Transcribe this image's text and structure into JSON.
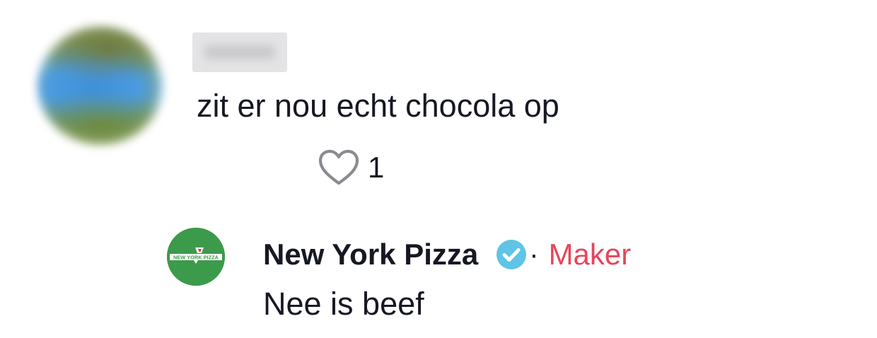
{
  "comment": {
    "text": "zit er nou echt chocola op",
    "like_count": "1",
    "avatar_icon": "user-avatar-blurred"
  },
  "reply": {
    "author": "New York Pizza",
    "separator": "·",
    "badge": "Maker",
    "text": "Nee is beef",
    "avatar_logo_text": "NEW YORK PIZZA",
    "verified_icon": "verified-check-icon"
  },
  "colors": {
    "text": "#161823",
    "maker": "#e8445a",
    "verified": "#5fc4e6",
    "nyp_green": "#3c9a4b",
    "heart_outline": "#8a8b91"
  }
}
